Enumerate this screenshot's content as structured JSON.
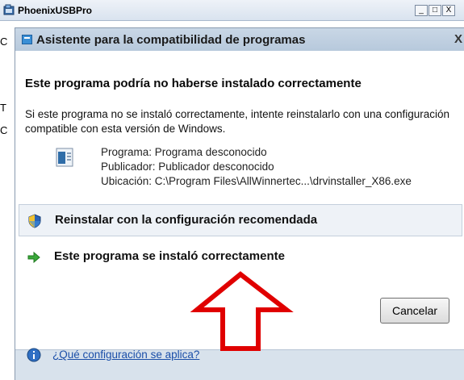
{
  "background_window": {
    "title": "PhoenixUSBPro",
    "controls": {
      "minimize": "_",
      "maximize": "□",
      "close": "X"
    },
    "partial_letters": [
      "C",
      "T",
      "C"
    ]
  },
  "dialog": {
    "title": "Asistente para la compatibilidad de programas",
    "close": "X",
    "heading": "Este programa podría no haberse instalado correctamente",
    "info": "Si este programa no se instaló correctamente, intente reinstalarlo con una configuración compatible con esta versión de Windows.",
    "program": {
      "name": "Programa: Programa desconocido",
      "publisher": "Publicador: Publicador desconocido",
      "location": "Ubicación: C:\\Program Files\\AllWinnertec...\\drvinstaller_X86.exe",
      "icon": "program-icon"
    },
    "options": [
      {
        "label": "Reinstalar con la configuración recomendada",
        "icon": "shield-icon"
      },
      {
        "label": "Este programa se instaló correctamente",
        "icon": "green-arrow-icon"
      }
    ],
    "cancel_label": "Cancelar",
    "help_link": "¿Qué configuración se aplica?",
    "help_icon": "info-icon"
  },
  "annotation": {
    "type": "red-outline-arrow",
    "color": "#e00000"
  },
  "colors": {
    "link": "#1a4ea8",
    "dialog_bg": "#d8e2ec",
    "annotation": "#e00000"
  }
}
